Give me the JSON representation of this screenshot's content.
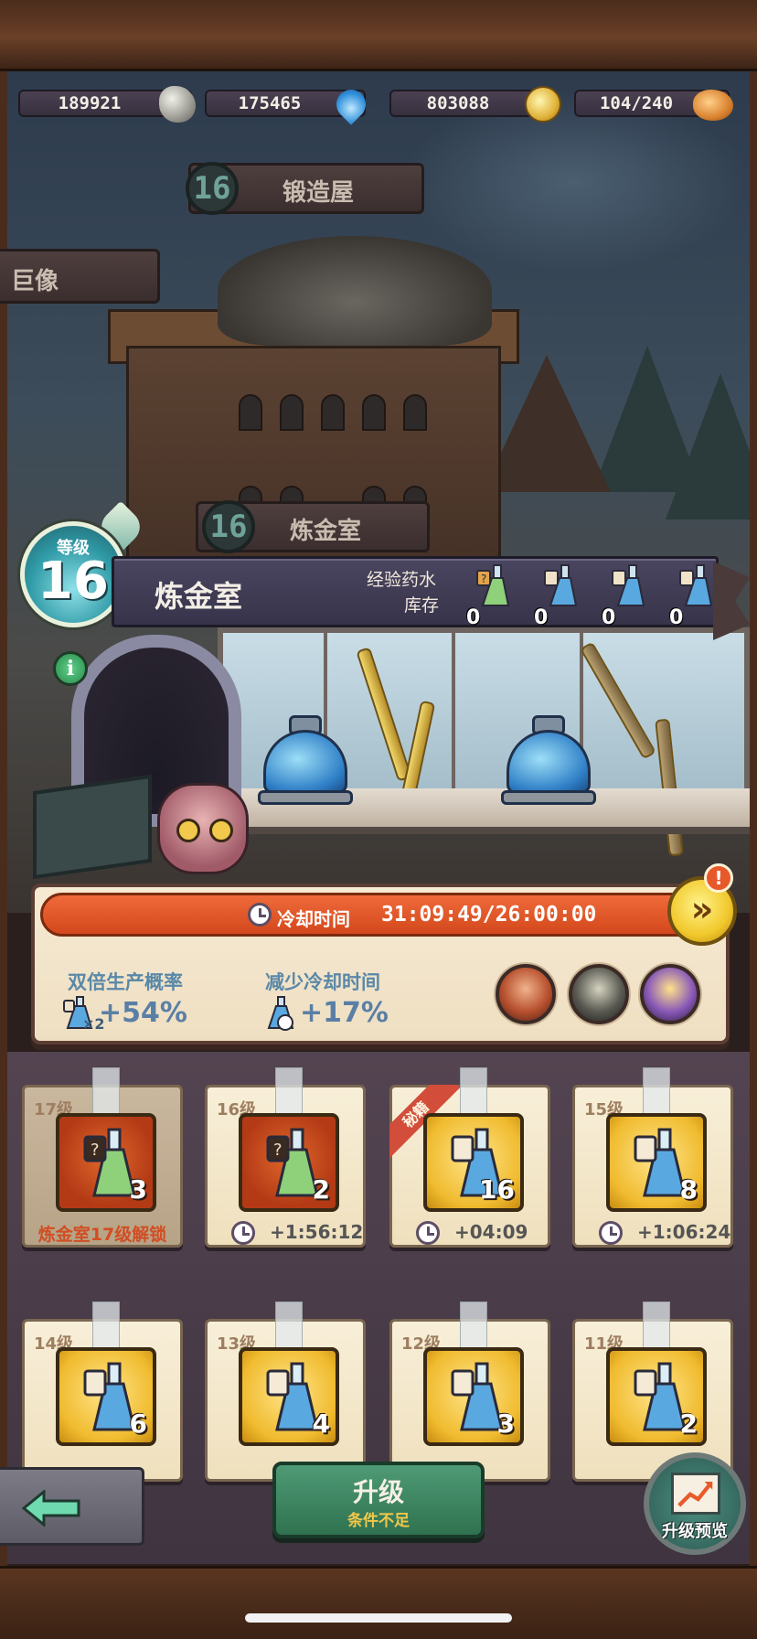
{
  "resources": [
    {
      "value": "189921",
      "icon": "stone-ore-icon"
    },
    {
      "value": "175465",
      "icon": "water-drop-icon"
    },
    {
      "value": "803088",
      "icon": "gold-coin-icon"
    },
    {
      "value": "104/240",
      "icon": "bread-icon"
    }
  ],
  "map": {
    "forge": {
      "level": "16",
      "name": "锻造屋"
    },
    "colossus": {
      "name": "巨像"
    },
    "alchemy": {
      "level": "16",
      "name": "炼金室"
    }
  },
  "header": {
    "level_label": "等级",
    "level": "16",
    "title": "炼金室",
    "exp_label": "经验药水",
    "stock_label": "库存",
    "potions": [
      {
        "count": "0",
        "icon": "mystery-flask-icon"
      },
      {
        "count": "0",
        "icon": "flask-icon"
      },
      {
        "count": "0",
        "icon": "flask-icon"
      },
      {
        "count": "0",
        "icon": "flask-icon"
      }
    ],
    "info_label": "i"
  },
  "cooldown": {
    "label": "冷却时间",
    "time": "31:09:49/26:00:00",
    "skip_label": "»",
    "alert": "!",
    "double_label": "双倍生产概率",
    "double_value": "+54%",
    "double_mult": "×2",
    "reduce_label": "减少冷却时间",
    "reduce_value": "+17%"
  },
  "heroes": [
    "hero-portrait-red-hair",
    "hero-portrait-masked-gunner",
    "hero-portrait-purple-knight"
  ],
  "recipes": [
    {
      "level": "17级",
      "count": "3",
      "style": "red",
      "locked": true,
      "footer": "炼金室17级解锁"
    },
    {
      "level": "16级",
      "count": "2",
      "style": "red",
      "locked": false,
      "time": "+1:56:12"
    },
    {
      "level": "",
      "count": "16",
      "style": "gold",
      "locked": false,
      "time": "+04:09",
      "ribbon": "秘籍"
    },
    {
      "level": "15级",
      "count": "8",
      "style": "gold",
      "locked": false,
      "time": "+1:06:24"
    },
    {
      "level": "14级",
      "count": "6",
      "style": "gold",
      "locked": false
    },
    {
      "level": "13级",
      "count": "4",
      "style": "gold",
      "locked": false
    },
    {
      "level": "12级",
      "count": "3",
      "style": "gold",
      "locked": false
    },
    {
      "level": "11级",
      "count": "2",
      "style": "gold",
      "locked": false
    }
  ],
  "footer": {
    "upgrade_label": "升级",
    "upgrade_sub": "条件不足",
    "preview_label": "升级预览"
  },
  "colors": {
    "accent_orange": "#d3481c",
    "upgrade_green": "#2f7250",
    "stat_blue": "#5a88a8"
  }
}
